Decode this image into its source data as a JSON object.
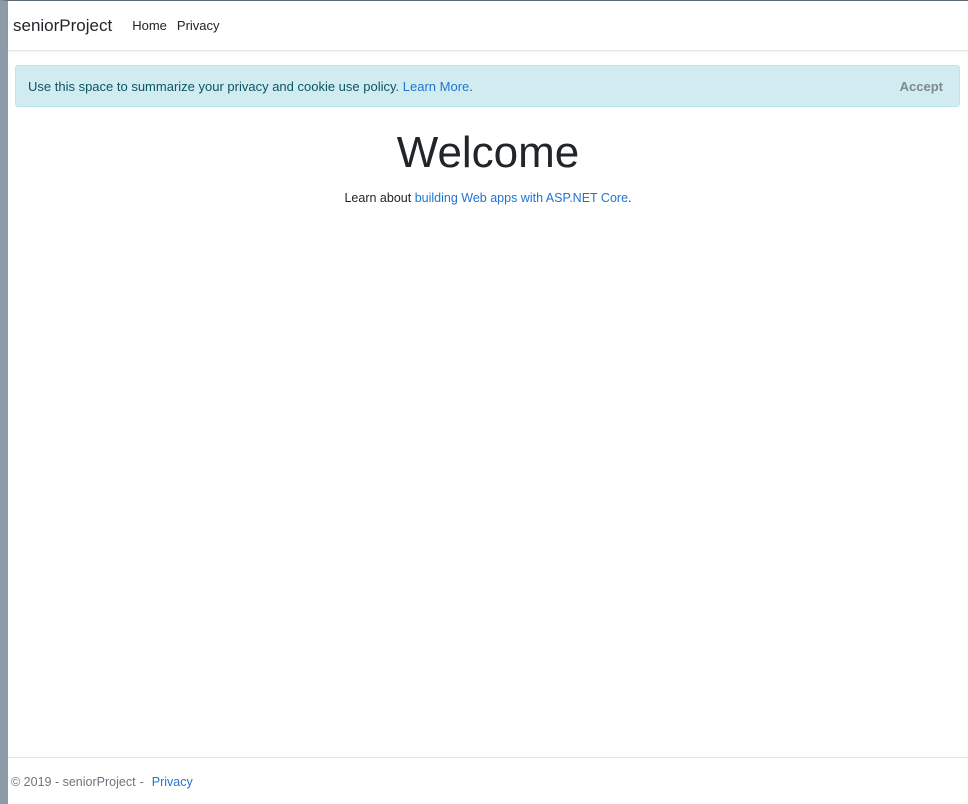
{
  "navbar": {
    "brand": "seniorProject",
    "links": [
      {
        "label": "Home"
      },
      {
        "label": "Privacy"
      }
    ]
  },
  "cookie_consent": {
    "message": "Use this space to summarize your privacy and cookie use policy.",
    "learn_more_label": "Learn More",
    "learn_more_suffix": ".",
    "accept_label": "Accept"
  },
  "main": {
    "heading": "Welcome",
    "learn_prefix": "Learn about",
    "learn_link": "building Web apps with ASP.NET Core",
    "learn_suffix": "."
  },
  "footer": {
    "copyright": "© 2019 - seniorProject",
    "separator": "-",
    "privacy_label": "Privacy"
  },
  "colors": {
    "link": "#1f74d2",
    "alert_bg": "#d1ecf1",
    "alert_text": "#0c5460"
  }
}
